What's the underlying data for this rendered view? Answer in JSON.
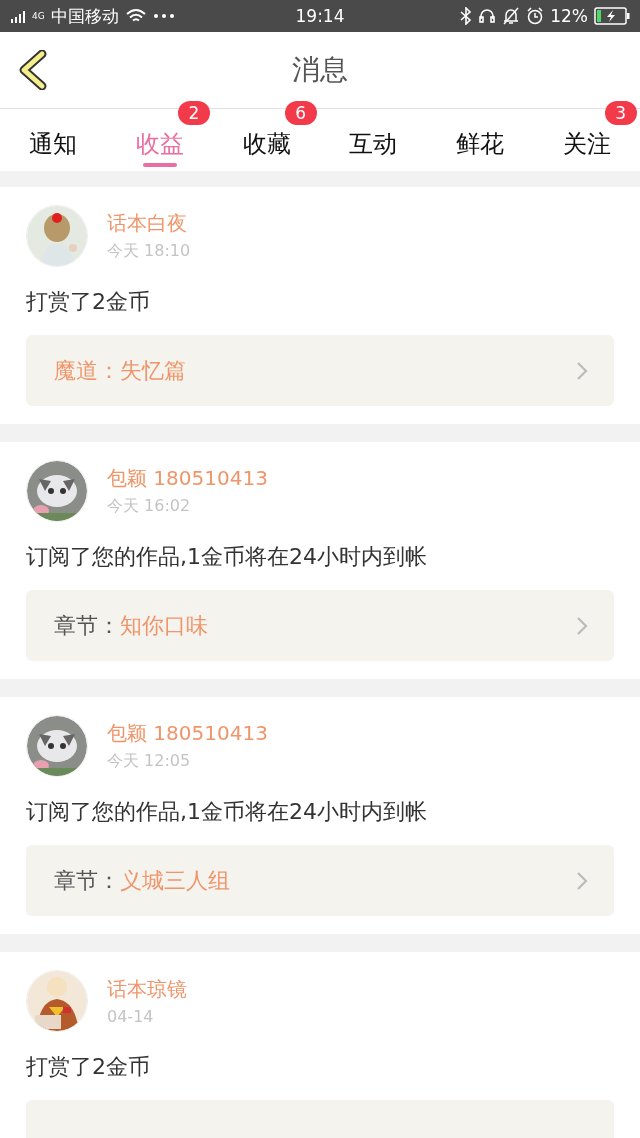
{
  "status_bar": {
    "network": "4G",
    "carrier": "中国移动",
    "time": "19:14",
    "battery": "12%"
  },
  "header": {
    "title": "消息"
  },
  "tabs": [
    {
      "label": "通知",
      "selected": false
    },
    {
      "label": "收益",
      "selected": true,
      "badge": "2"
    },
    {
      "label": "收藏",
      "selected": false,
      "badge": "6"
    },
    {
      "label": "互动",
      "selected": false
    },
    {
      "label": "鲜花",
      "selected": false
    },
    {
      "label": "关注",
      "selected": false,
      "badge": "3"
    }
  ],
  "messages": [
    {
      "user": "话本白夜",
      "time": "今天 18:10",
      "text": "打赏了2金币",
      "link": {
        "label": "魔道：",
        "value": "失忆篇",
        "label_accent": true,
        "cut_off": false
      }
    },
    {
      "user": "包颖 180510413",
      "time": "今天 16:02",
      "text": "订阅了您的作品,1金币将在24小时内到帐",
      "link": {
        "label": "章节：",
        "value": "知你口味",
        "label_accent": false,
        "cut_off": false
      }
    },
    {
      "user": "包颖 180510413",
      "time": "今天 12:05",
      "text": "订阅了您的作品,1金币将在24小时内到帐",
      "link": {
        "label": "章节：",
        "value": "义城三人组",
        "label_accent": false,
        "cut_off": false
      }
    },
    {
      "user": "话本琼镜",
      "time": "04-14",
      "text": "打赏了2金币",
      "link": {
        "cut_off": true
      }
    }
  ]
}
